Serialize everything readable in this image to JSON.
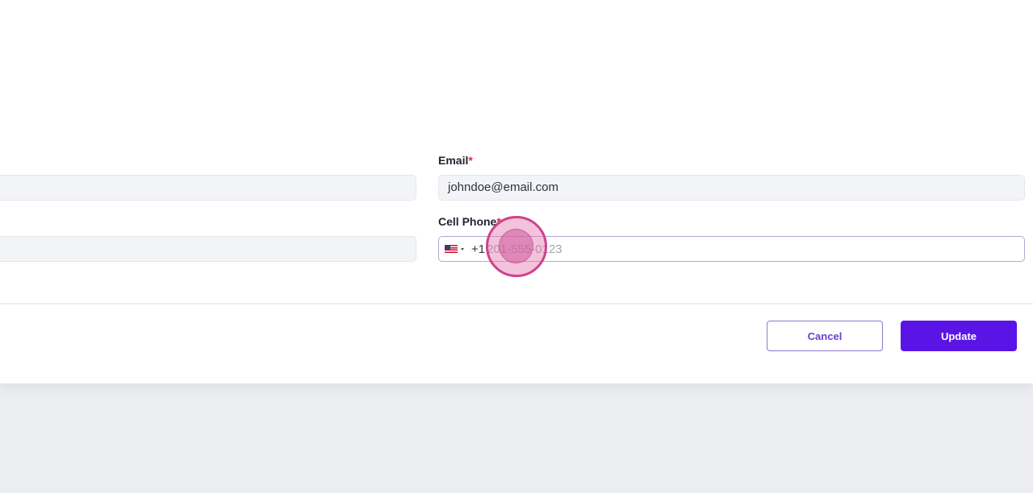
{
  "form": {
    "email": {
      "label": "Email",
      "required_mark": "*",
      "value": "johndoe@email.com"
    },
    "cell_phone": {
      "label": "Cell Phone",
      "required_mark": "*",
      "country_flag": "us-flag-icon",
      "dial_code": "+1",
      "value": "",
      "placeholder": "201-555-0123"
    }
  },
  "actions": {
    "cancel_label": "Cancel",
    "update_label": "Update"
  },
  "colors": {
    "primary": "#5a14e6",
    "required": "#e0245e",
    "click_indicator": "#d0428c"
  }
}
